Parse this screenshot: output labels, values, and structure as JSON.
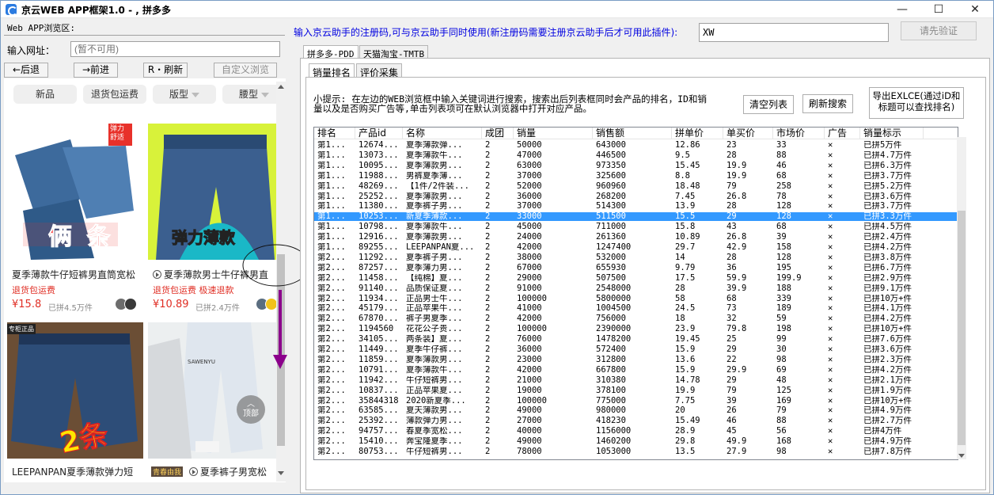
{
  "app": {
    "title": "京云WEB APP框架1.0 - , 拼多多",
    "min_glyph": "—",
    "max_glyph": "☐",
    "close_glyph": "✕"
  },
  "left": {
    "browse_label": "Web APP浏览区:",
    "url_label": "输入网址：",
    "url_placeholder": "(暂不可用)",
    "back": "←后退",
    "forward": "→前进",
    "refresh": "R・刷新",
    "custom": "自定义浏览"
  },
  "filters": [
    "新品",
    "退货包运费",
    "版型",
    "腰型"
  ],
  "products": [
    {
      "title": "夏季薄款牛仔短裤男直筒宽松",
      "tag": "退货包运费",
      "price": "¥15.8",
      "sold": "已拼4.5万件",
      "badge": "俩 条",
      "ribbon": "弹力舒适"
    },
    {
      "title": "夏季薄款男士牛仔裤男直",
      "tag": "退货包运费  极速退款",
      "price": "¥10.89",
      "sold": "已拼2.4万件",
      "badge": "弹力薄款",
      "ribbon": ""
    },
    {
      "title": "LEEPANPAN夏季薄款弹力短",
      "tag": "",
      "price": "",
      "sold": "",
      "badge": "2条",
      "ribbon": "专柜正品"
    },
    {
      "title": "夏季裤子男宽松",
      "tag": "",
      "price": "",
      "sold": "",
      "badge": "SAWENYU",
      "ribbon": "青春由我"
    }
  ],
  "top_btn": "顶部",
  "right": {
    "hint": "输入京云助手的注册码,可与京云助手同时使用(新注册码需要注册京云助手后才可用此插件):",
    "reg_code": "XW",
    "verify": "请先验证",
    "tabs": [
      "拼多多-PDD",
      "天猫淘宝-TMTB"
    ],
    "subtabs": [
      "销量排名",
      "评价采集"
    ],
    "tip": "小提示: 在左边的WEB浏览框中输入关键词进行搜索，搜索出后列表框同时会产品的排名，ID和销量以及是否购买广告等,单击列表项可在默认浏览器中打开对应产品。",
    "clear": "清空列表",
    "refresh": "刷新搜索",
    "export": "导出EXLCE(通过iD和标题可以查找排名)"
  },
  "grid": {
    "columns": [
      "排名",
      "产品id",
      "名称",
      "成团",
      "销量",
      "销售额",
      "拼单价",
      "单买价",
      "市场价",
      "广告",
      "销量标示"
    ],
    "selected_index": 7,
    "rows": [
      [
        "第1...",
        "12674...",
        "夏季薄款弹...",
        "2",
        "50000",
        "643000",
        "12.86",
        "23",
        "33",
        "✕",
        "已拼5万件"
      ],
      [
        "第1...",
        "13073...",
        "夏季薄款牛...",
        "2",
        "47000",
        "446500",
        "9.5",
        "28",
        "88",
        "✕",
        "已拼4.7万件"
      ],
      [
        "第1...",
        "10095...",
        "夏季薄款男...",
        "2",
        "63000",
        "973350",
        "15.45",
        "19.9",
        "46",
        "✕",
        "已拼6.3万件"
      ],
      [
        "第1...",
        "11988...",
        "男裤夏季薄...",
        "2",
        "37000",
        "325600",
        "8.8",
        "19.9",
        "68",
        "✕",
        "已拼3.7万件"
      ],
      [
        "第1...",
        "48269...",
        "【1件/2件装...",
        "2",
        "52000",
        "960960",
        "18.48",
        "79",
        "258",
        "✕",
        "已拼5.2万件"
      ],
      [
        "第1...",
        "25252...",
        "夏季薄款男...",
        "2",
        "36000",
        "268200",
        "7.45",
        "26.8",
        "78",
        "✕",
        "已拼3.6万件"
      ],
      [
        "第1...",
        "11380...",
        "夏季裤子男...",
        "2",
        "37000",
        "514300",
        "13.9",
        "28",
        "128",
        "✕",
        "已拼3.7万件"
      ],
      [
        "第1...",
        "10253...",
        "新夏季薄款...",
        "2",
        "33000",
        "511500",
        "15.5",
        "29",
        "128",
        "✕",
        "已拼3.3万件"
      ],
      [
        "第1...",
        "10798...",
        "夏季薄款牛...",
        "2",
        "45000",
        "711000",
        "15.8",
        "43",
        "68",
        "✕",
        "已拼4.5万件"
      ],
      [
        "第1...",
        "12916...",
        "夏季薄款男...",
        "2",
        "24000",
        "261360",
        "10.89",
        "26.8",
        "39",
        "✕",
        "已拼2.4万件"
      ],
      [
        "第1...",
        "89255...",
        "LEEPANPAN夏...",
        "2",
        "42000",
        "1247400",
        "29.7",
        "42.9",
        "158",
        "✕",
        "已拼4.2万件"
      ],
      [
        "第2...",
        "11292...",
        "夏季裤子男...",
        "2",
        "38000",
        "532000",
        "14",
        "28",
        "128",
        "✕",
        "已拼3.8万件"
      ],
      [
        "第2...",
        "87257...",
        "夏季薄力男...",
        "2",
        "67000",
        "655930",
        "9.79",
        "36",
        "195",
        "✕",
        "已拼6.7万件"
      ],
      [
        "第2...",
        "11458...",
        "【纯棉】夏...",
        "2",
        "29000",
        "507500",
        "17.5",
        "59.9",
        "199.9",
        "✕",
        "已拼2.9万件"
      ],
      [
        "第2...",
        "91140...",
        "品质保证夏...",
        "2",
        "91000",
        "2548000",
        "28",
        "39.9",
        "188",
        "✕",
        "已拼9.1万件"
      ],
      [
        "第2...",
        "11934...",
        "正品男士牛...",
        "2",
        "100000",
        "5800000",
        "58",
        "68",
        "339",
        "✕",
        "已拼10万+件"
      ],
      [
        "第2...",
        "45179...",
        "正品苹果牛...",
        "2",
        "41000",
        "1004500",
        "24.5",
        "73",
        "189",
        "✕",
        "已拼4.1万件"
      ],
      [
        "第2...",
        "67870...",
        "裤子男夏季...",
        "2",
        "42000",
        "756000",
        "18",
        "32",
        "59",
        "✕",
        "已拼4.2万件"
      ],
      [
        "第2...",
        "1194560",
        "花花公子贵...",
        "2",
        "100000",
        "2390000",
        "23.9",
        "79.8",
        "198",
        "✕",
        "已拼10万+件"
      ],
      [
        "第2...",
        "34105...",
        "两条装】夏...",
        "2",
        "76000",
        "1478200",
        "19.45",
        "25",
        "99",
        "✕",
        "已拼7.6万件"
      ],
      [
        "第2...",
        "11449...",
        "夏季牛仔裤...",
        "2",
        "36000",
        "572400",
        "15.9",
        "29",
        "30",
        "✕",
        "已拼3.6万件"
      ],
      [
        "第2...",
        "11859...",
        "夏季薄款男...",
        "2",
        "23000",
        "312800",
        "13.6",
        "22",
        "98",
        "✕",
        "已拼2.3万件"
      ],
      [
        "第2...",
        "10791...",
        "夏季薄款牛...",
        "2",
        "42000",
        "667800",
        "15.9",
        "29.9",
        "69",
        "✕",
        "已拼4.2万件"
      ],
      [
        "第2...",
        "11942...",
        "牛仔短裤男...",
        "2",
        "21000",
        "310380",
        "14.78",
        "29",
        "48",
        "✕",
        "已拼2.1万件"
      ],
      [
        "第2...",
        "10837...",
        "正品苹果夏...",
        "2",
        "19000",
        "378100",
        "19.9",
        "79",
        "125",
        "✕",
        "已拼1.9万件"
      ],
      [
        "第2...",
        "35844318",
        "2020新夏季...",
        "2",
        "100000",
        "775000",
        "7.75",
        "39",
        "169",
        "✕",
        "已拼10万+件"
      ],
      [
        "第2...",
        "63585...",
        "夏天薄款男...",
        "2",
        "49000",
        "980000",
        "20",
        "26",
        "79",
        "✕",
        "已拼4.9万件"
      ],
      [
        "第2...",
        "25392...",
        "薄款弹力男...",
        "2",
        "27000",
        "418230",
        "15.49",
        "46",
        "88",
        "✕",
        "已拼2.7万件"
      ],
      [
        "第2...",
        "94757...",
        "春夏季宽松...",
        "2",
        "40000",
        "1156000",
        "28.9",
        "45",
        "56",
        "✕",
        "已拼4万件"
      ],
      [
        "第2...",
        "15410...",
        "奔宝隆夏季...",
        "2",
        "49000",
        "1460200",
        "29.8",
        "49.9",
        "168",
        "✕",
        "已拼4.9万件"
      ],
      [
        "第2...",
        "80753...",
        "牛仔短裤男...",
        "2",
        "78000",
        "1053000",
        "13.5",
        "27.9",
        "98",
        "✕",
        "已拼7.8万件"
      ]
    ]
  },
  "colors": {
    "selection": "#3399ff",
    "price": "#e02e24",
    "hint": "#0000e0",
    "annotation": "#8b008b"
  }
}
